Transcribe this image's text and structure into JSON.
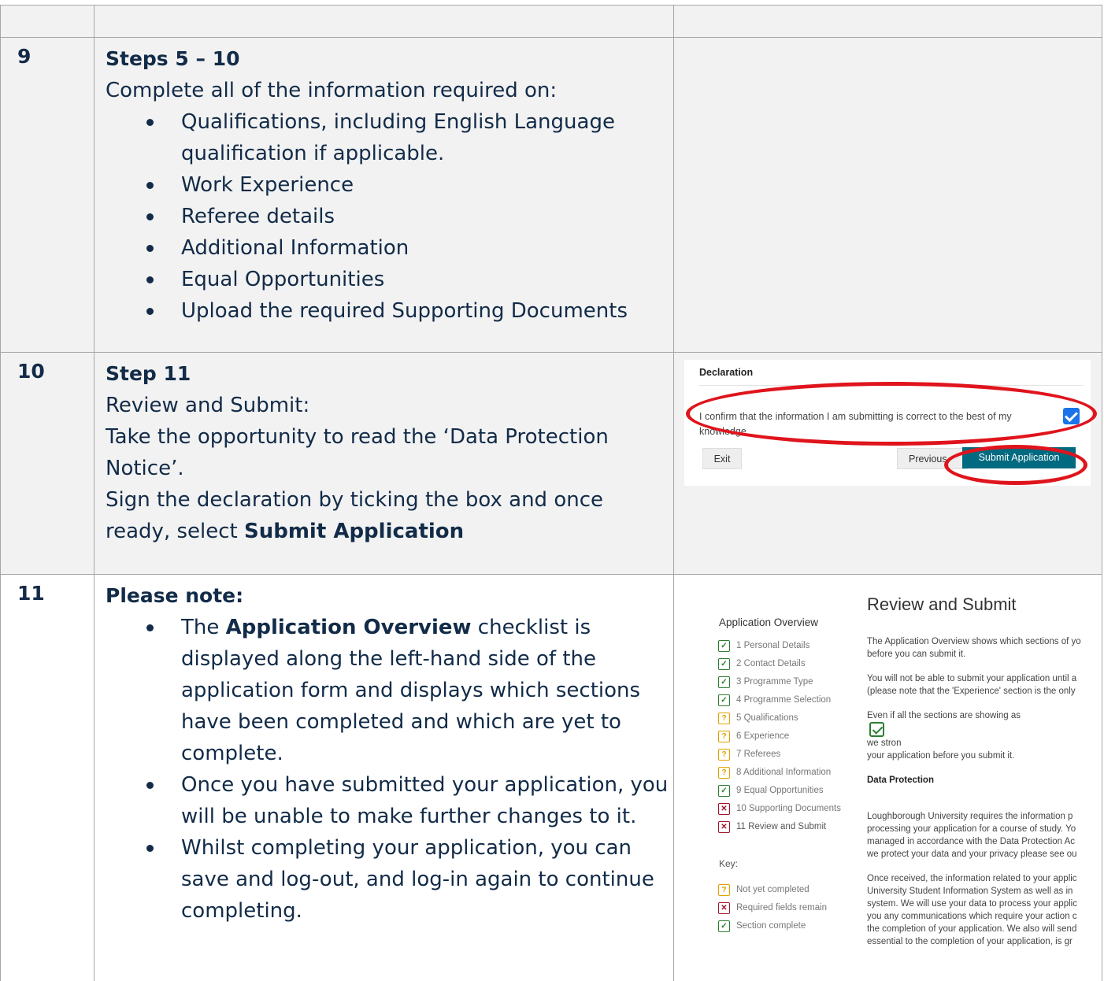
{
  "rows": [
    {
      "number": "9",
      "heading": "Steps 5 – 10",
      "intro": "Complete all of the information required on:",
      "bullets": [
        "Qualifications, including English Language qualification if applicable.",
        "Work Experience",
        "Referee details",
        "Additional Information",
        "Equal Opportunities",
        "Upload the required Supporting Documents"
      ]
    },
    {
      "number": "10",
      "heading": "Step 11",
      "line1": "Review and Submit:",
      "line2": "Take the opportunity to read the ‘Data Protection Notice’.",
      "line3_prefix": "Sign the declaration by ticking the box and once ready, select ",
      "line3_bold": "Submit Application"
    },
    {
      "number": "11",
      "heading": "Please note:",
      "bullet1_prefix": "The ",
      "bullet1_bold": "Application Overview",
      "bullet1_suffix": " checklist is displayed along the left-hand side of the application form and displays which sections have been completed and which are yet to complete.",
      "bullet2": "Once you have submitted your application, you will be unable to make further changes to it.",
      "bullet3": "Whilst completing your application, you can save and log-out, and log-in again to continue completing."
    }
  ],
  "declaration": {
    "title": "Declaration",
    "text": "I confirm that the information I am submitting is correct to the best of my knowledge.",
    "checked": true,
    "exit_label": "Exit",
    "previous_label": "Previous",
    "submit_label": "Submit Application",
    "highlight_color": "#e0141c",
    "submit_color": "#006a80"
  },
  "overview": {
    "title": "Application Overview",
    "items": [
      {
        "label": "1 Personal Details",
        "status": "complete"
      },
      {
        "label": "2 Contact Details",
        "status": "complete"
      },
      {
        "label": "3 Programme Type",
        "status": "complete"
      },
      {
        "label": "4 Programme Selection",
        "status": "complete"
      },
      {
        "label": "5 Qualifications",
        "status": "not-yet"
      },
      {
        "label": "6 Experience",
        "status": "not-yet"
      },
      {
        "label": "7 Referees",
        "status": "not-yet"
      },
      {
        "label": "8 Additional Information",
        "status": "not-yet"
      },
      {
        "label": "9 Equal Opportunities",
        "status": "complete"
      },
      {
        "label": "10 Supporting Documents",
        "status": "required"
      },
      {
        "label": "11 Review and Submit",
        "status": "required"
      }
    ],
    "key_label": "Key:",
    "key": [
      {
        "label": "Not yet completed",
        "status": "not-yet"
      },
      {
        "label": "Required fields remain",
        "status": "required"
      },
      {
        "label": "Section complete",
        "status": "complete"
      }
    ]
  },
  "review": {
    "title": "Review and Submit",
    "p1a": "The Application Overview shows which sections of yo",
    "p1b": "before you can submit it.",
    "p2a": "You will not be able to submit your application until a",
    "p2b": "(please note that the 'Experience' section is the only",
    "p3a_prefix": "Even if all the sections are showing as",
    "p3a_suffix": "we stron",
    "p3b": "your application before you submit it.",
    "dp_heading": "Data Protection",
    "dp1": "Loughborough University requires the information p",
    "dp2": "processing your application for a course of study. Yo",
    "dp3": "managed in accordance with the Data Protection Ac",
    "dp4": "we protect your data and your privacy please see ou",
    "dp5": "Once received, the information related to your applic",
    "dp6": "University Student Information System as well as in",
    "dp7": "system. We will use your data to process your applic",
    "dp8": "you any communications which require your action c",
    "dp9": "the completion of your application. We also will send",
    "dp10": "essential to the completion of your application, is gr"
  },
  "icons": {
    "complete": "check-icon",
    "not-yet": "question-icon",
    "required": "cross-icon"
  }
}
